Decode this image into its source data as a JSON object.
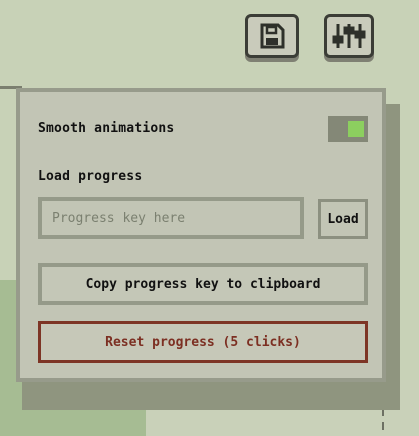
{
  "toolbar": {
    "save_icon": "floppy-disk-icon",
    "settings_icon": "sliders-icon"
  },
  "settings": {
    "smooth_animations_label": "Smooth animations",
    "smooth_animations_enabled": true,
    "load_progress_label": "Load progress",
    "progress_key_placeholder": "Progress key here",
    "progress_key_value": "",
    "load_button_label": "Load",
    "copy_button_label": "Copy progress key to clipboard",
    "reset_button_label": "Reset progress (5 clicks)"
  },
  "colors": {
    "toggle_on": "#8ccf5f",
    "danger": "#7c2f22",
    "background": "#c8d2b7"
  }
}
